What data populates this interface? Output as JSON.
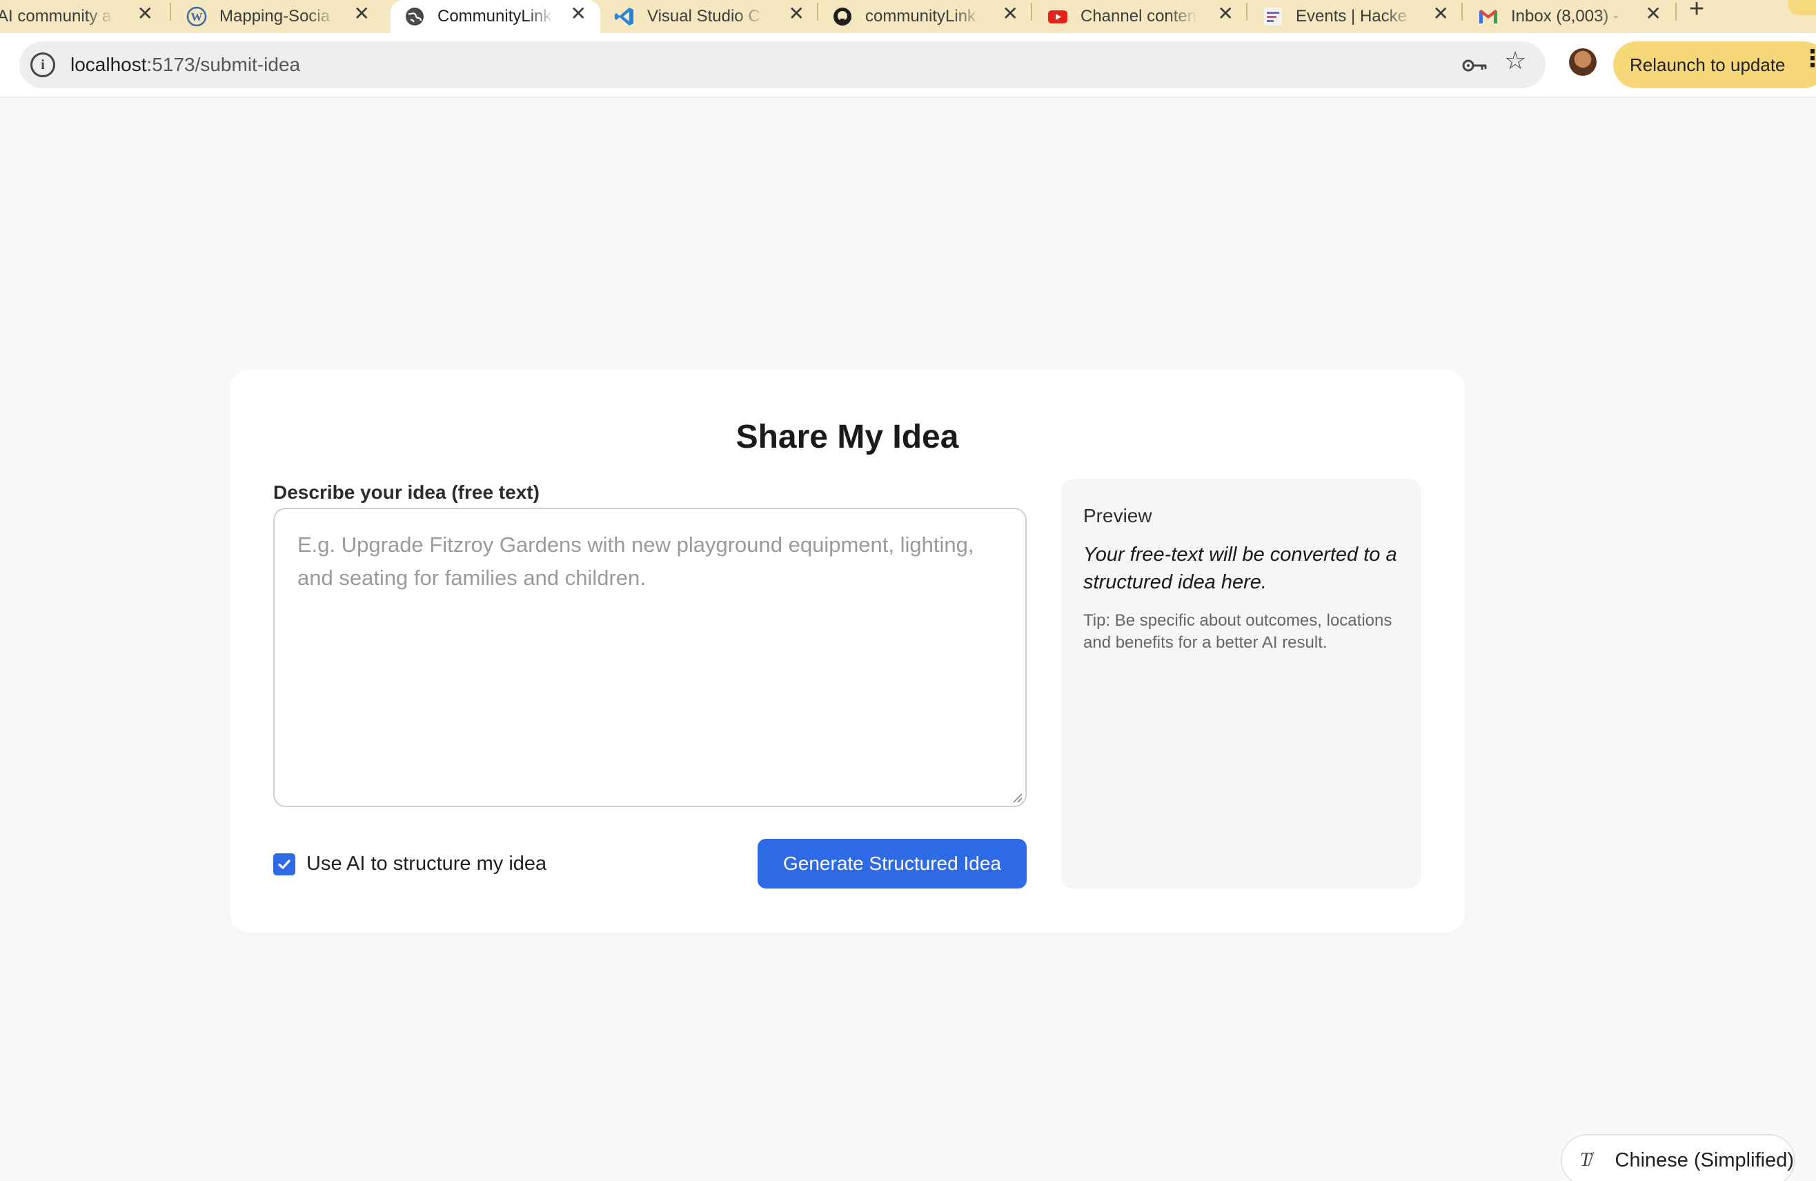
{
  "browser": {
    "tabs": [
      {
        "title": "AI community a",
        "favicon": "none",
        "active": false
      },
      {
        "title": "Mapping-Socia",
        "favicon": "wordpress-icon",
        "active": false
      },
      {
        "title": "CommunityLink",
        "favicon": "globe-icon",
        "active": true
      },
      {
        "title": "Visual Studio C",
        "favicon": "vscode-icon",
        "active": false
      },
      {
        "title": "communityLink",
        "favicon": "github-icon",
        "active": false
      },
      {
        "title": "Channel conten",
        "favicon": "youtube-icon",
        "active": false
      },
      {
        "title": "Events | Hacke",
        "favicon": "hackathon-icon",
        "active": false
      },
      {
        "title": "Inbox (8,003) -",
        "favicon": "gmail-icon",
        "active": false
      }
    ],
    "new_tab_label": "+",
    "close_glyph": "✕",
    "url_host": "localhost",
    "url_path": ":5173/submit-idea",
    "relaunch_label": "Relaunch to update",
    "colors": {
      "tabstrip": "#f5e8c0",
      "relaunch": "#f7d879"
    }
  },
  "page": {
    "title": "Share My Idea",
    "idea_label": "Describe your idea (free text)",
    "idea_placeholder": "E.g. Upgrade Fitzroy Gardens with new playground equipment, lighting, and seating for families and children.",
    "use_ai_label": "Use AI to structure my idea",
    "use_ai_checked": true,
    "generate_button": "Generate Structured Idea",
    "preview": {
      "title": "Preview",
      "body": "Your free-text will be converted to a structured idea here.",
      "tip": "Tip: Be specific about outcomes, locations and benefits for a better AI result."
    },
    "colors": {
      "accent": "#2f6ae6"
    }
  },
  "translate_popup": {
    "language": "Chinese (Simplified)",
    "icon": "translate-icon"
  }
}
